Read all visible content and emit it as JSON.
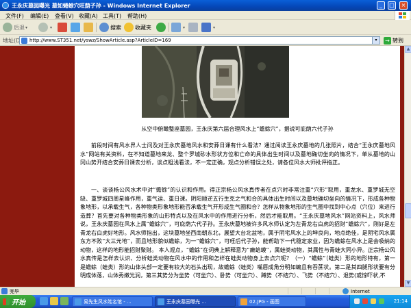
{
  "window": {
    "title": "王永庆墓园曝光 墓如蜷蜍穴旺荫子孙 - Windows Internet Explorer",
    "minimize": "_",
    "maximize": "□",
    "close": "×"
  },
  "menu": {
    "items": [
      "文件(F)",
      "编辑(E)",
      "查看(V)",
      "收藏(A)",
      "工具(T)",
      "帮助(H)"
    ]
  },
  "toolbar": {
    "back": "后退",
    "search": "搜索",
    "favorites": "收藏夹",
    "dropdown": "▾"
  },
  "address": {
    "label": "地址(D)",
    "url": "http://www.ST351.net/yswz/ShowArticle.asp?ArticleID=169",
    "go": "转到",
    "go_arrow": "→"
  },
  "article": {
    "caption": "从空中俯瞰整座墓园，王永庆第六届合理风水上“蟾蜍穴”，据说可庇荫六代子孙",
    "paragraphs": [
      "前段时间有风水界人士问及对王永庆墓地风水和安葬日课有什么看法？通过阅读王永庆墓地的几张照片，结合“王永庆墓地风水”网站有关资料，在不知道墓地来龙、整个罗城砂水形状方位和亡命的具体出生时间以及墓地确切坐向的情况下，单从墓地的山冈山势开结合安葬日课去分析，谈点粗浅看法，不一定正确，观点分析错误之处，请各位风水大师批评指正。",
      "一、谈谈杨公风水术中对“蟾蜍”的认识和作用。得正宗杨公风水真传者在点穴时非常注重“穴形”取用，重龙水、重罗城无空缺、重罗城四周星峰作用，重气运、重日课。阴阳顺逆五行生克之气和合的具体出生时间以及墓地确切坐向的情况下，形成各种物象地形，以承载生气，各种物类形象地形能否承载生气开形成生气圈和合？怎样从物象地形的生气圈中找到中心点（穴位）来进行造葬？首先要对各种物类形象的山形特点以及在风水中的作用进行分析，然后才能取用。“王永庆墓地风水”网站资料上，风水师说，王永庆墓园在风水上属“蟾蜍穴”，可庇荫六代子孙。王永庆墓地被许多风水师认定为左青龙右白虎的招财“蟾蜍穴”，刚好是左青龙右白虎好地形。风水师指出，这块墓地坐西南朝东北，展望大台北盆地，属于阴宅风水上的坤良向，地点绝佳，是阴宅风水属东方不败“大三元地”，而且地形貌似蟾蜍，为一“蟾蜍穴”，可旺后代子孙，能帮助下一代稳定家业，因为蟾蜍在风水上是会吸纳的动物，这样的地形能招财聚财。 本人观点，“蟾蜍”在词典上解释意为“癞蛤蟆”，属蛙类动物，其属性与青蛙大同小异。正宗杨公风水真传是怎样去认识、分析蛙类动物在风水中的作用和怎样在蛙类动物身上去点穴呢？（一）“蟾蜍”（蛙类）形的地形特有，第一是蟾蜍（蛙类）形的山体头部一定要有较大的石头出现，故蟾蜍（蛙类）嘴唇成角分明如蝙且有吞蔗状。第二是其四腿形状要有分明成体落，山体秀嫩光润，第三其势分为坐势（可坐穴）、卧势（可坐穴）、蹲势（不结穴）、飞势（不结穴）、退势(或惊吓状,不"
    ]
  },
  "status": {
    "done": "完毕",
    "zone": "Internet"
  },
  "taskbar": {
    "start": "开始",
    "tasks": [
      "易先生风水姓名馆 - ...",
      "王永庆墓园曝光 ...",
      "02.JPG - 画图"
    ],
    "clock": "21:14"
  }
}
